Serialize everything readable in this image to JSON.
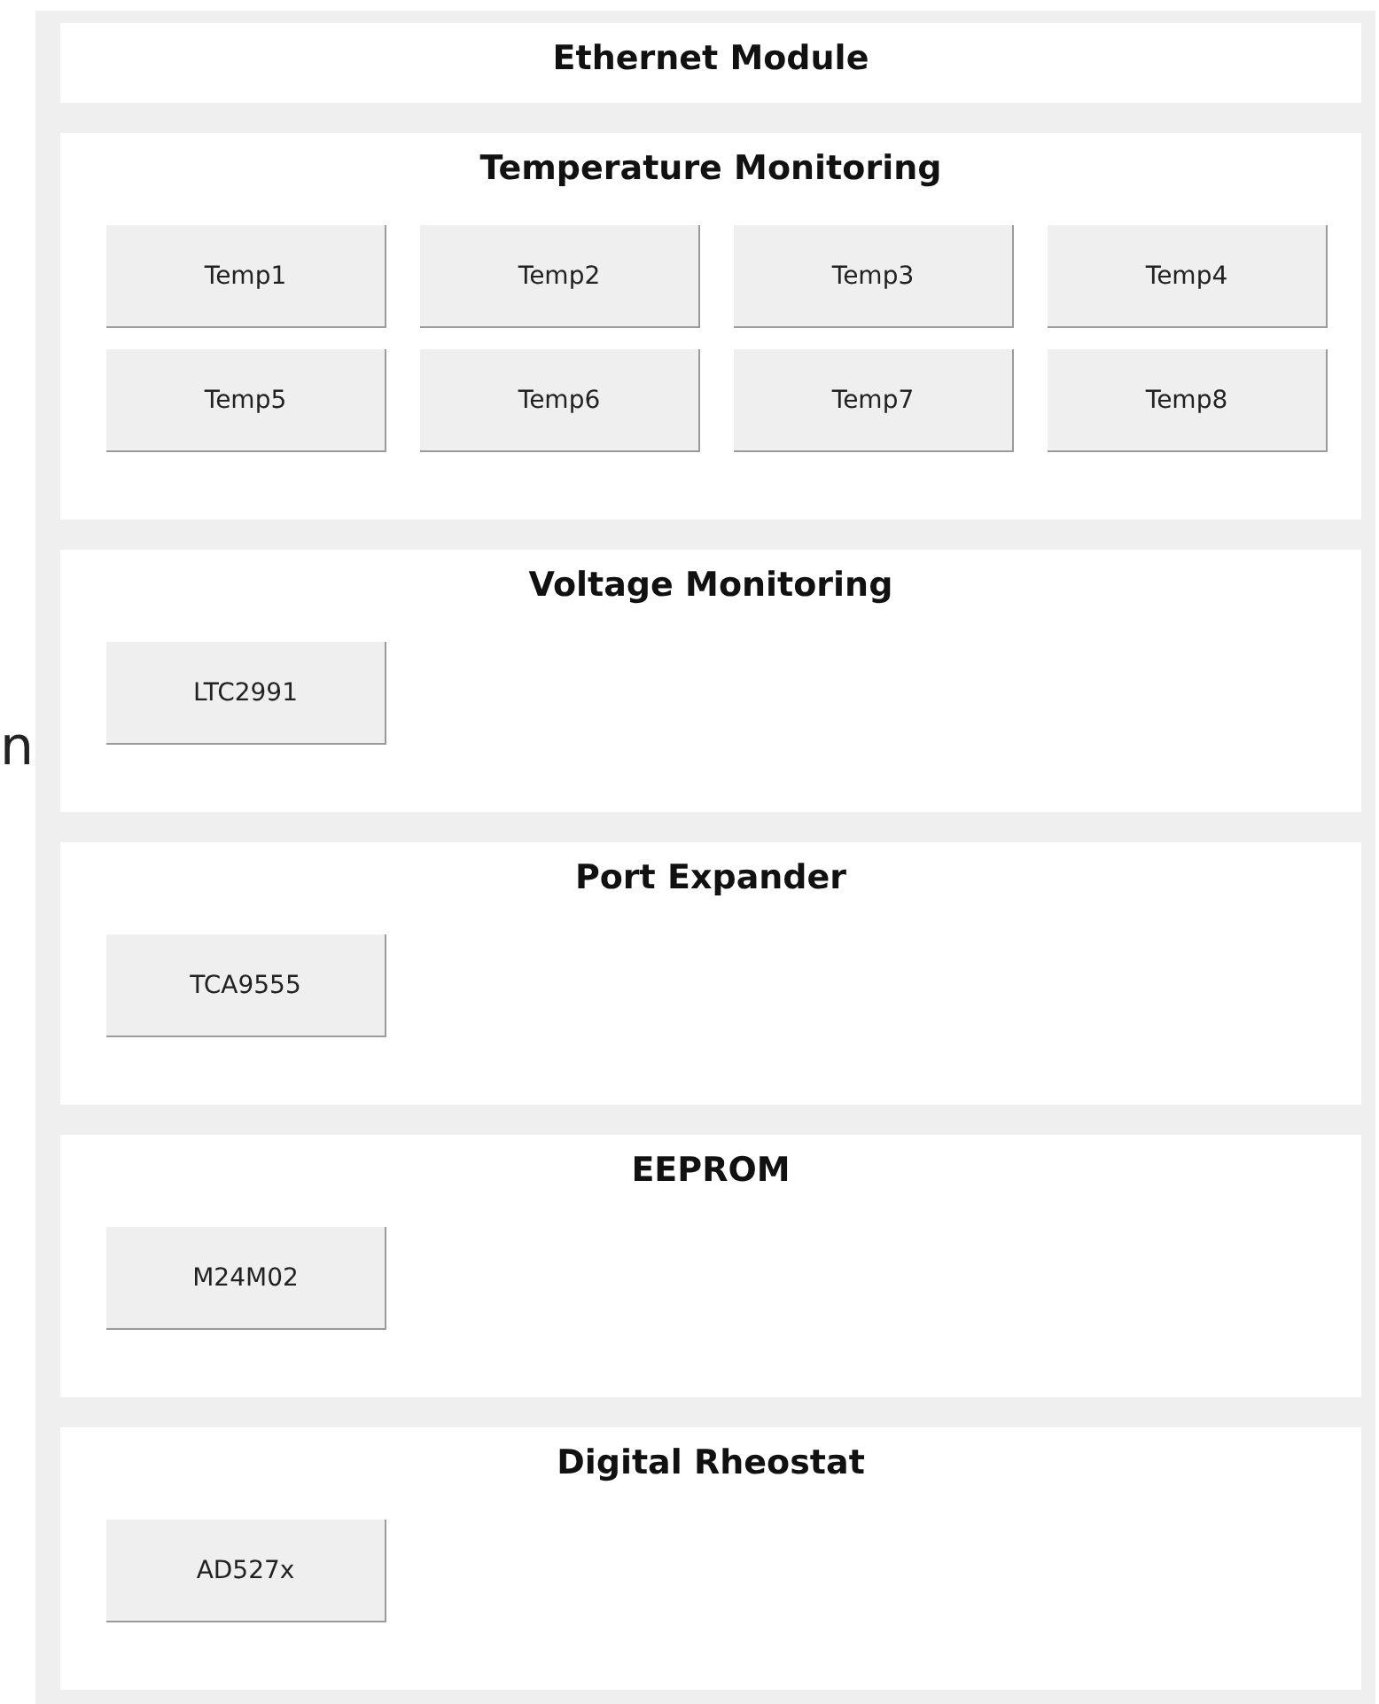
{
  "side_text": "n",
  "sections": [
    {
      "title": "Ethernet Module"
    },
    {
      "title": "Temperature Monitoring",
      "buttons": [
        "Temp1",
        "Temp2",
        "Temp3",
        "Temp4",
        "Temp5",
        "Temp6",
        "Temp7",
        "Temp8"
      ]
    },
    {
      "title": "Voltage Monitoring",
      "buttons": [
        "LTC2991"
      ]
    },
    {
      "title": "Port Expander",
      "buttons": [
        "TCA9555"
      ]
    },
    {
      "title": "EEPROM",
      "buttons": [
        "M24M02"
      ]
    },
    {
      "title": "Digital Rheostat",
      "buttons": [
        "AD527x"
      ]
    }
  ]
}
